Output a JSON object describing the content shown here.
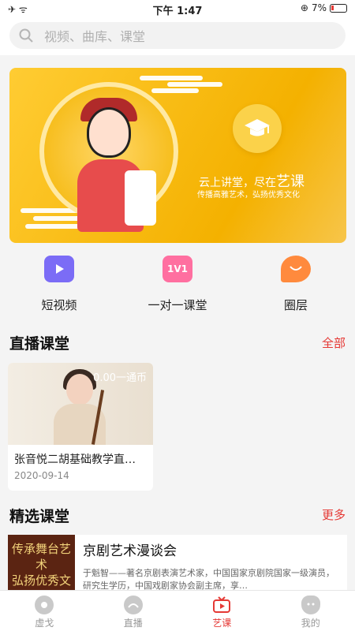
{
  "status": {
    "time": "下午 1:47",
    "battery": "7%"
  },
  "search": {
    "placeholder": "视频、曲库、课堂"
  },
  "banner": {
    "line1_prefix": "云上讲堂，尽在",
    "line1_emphasis": "艺课",
    "line2": "传播高雅艺术，弘扬优秀文化"
  },
  "quick": [
    {
      "label": "短视频",
      "icon": "play-icon",
      "color": "#7b6cf6"
    },
    {
      "label": "一对一课堂",
      "icon": "one-on-one-icon",
      "color": "#ff6fa0"
    },
    {
      "label": "圈层",
      "icon": "circle-chat-icon",
      "color": "#ff8a3d"
    }
  ],
  "live": {
    "title": "直播课堂",
    "more": "全部",
    "card": {
      "price": "0.00一通币",
      "title": "张音悦二胡基础教学直…",
      "date": "2020-09-14"
    }
  },
  "featured": {
    "title": "精选课堂",
    "more": "更多",
    "course": {
      "image_text1": "传承舞台艺术",
      "image_text2": "弘扬优秀文化",
      "title": "京剧艺术漫谈会",
      "desc": "于魁智——著名京剧表演艺术家，中国国家京剧院国家一级演员，研究生学历，中国戏剧家协会副主席，享…"
    }
  },
  "tabs": [
    {
      "label": "虚戈",
      "icon": "opera-icon"
    },
    {
      "label": "直播",
      "icon": "live-icon"
    },
    {
      "label": "艺课",
      "icon": "course-icon",
      "active": true
    },
    {
      "label": "我的",
      "icon": "mask-icon"
    }
  ]
}
